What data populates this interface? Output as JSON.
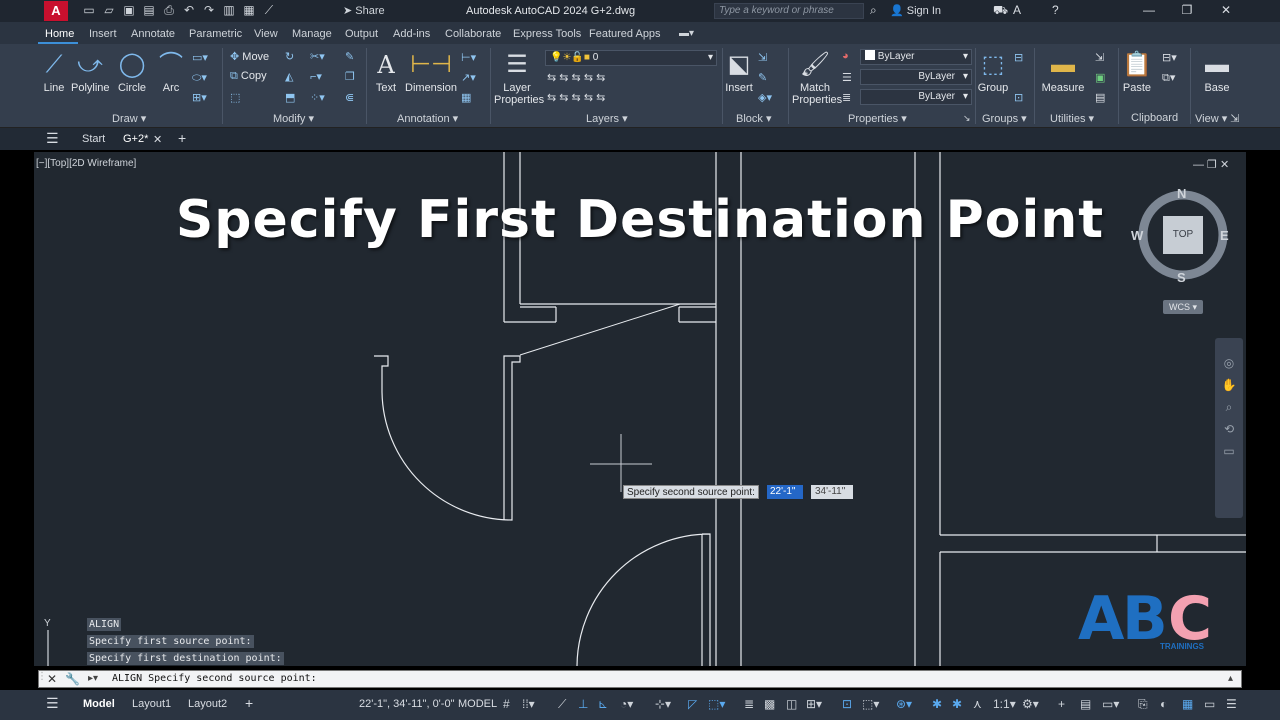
{
  "titlebar": {
    "logo": "A",
    "share": "Share",
    "title": "Autodesk AutoCAD 2024   G+2.dwg",
    "search_placeholder": "Type a keyword or phrase",
    "sign_in": "Sign In"
  },
  "ribbon_tabs": [
    "Home",
    "Insert",
    "Annotate",
    "Parametric",
    "View",
    "Manage",
    "Output",
    "Add-ins",
    "Collaborate",
    "Express Tools",
    "Featured Apps"
  ],
  "ribbon": {
    "draw": {
      "line": "Line",
      "polyline": "Polyline",
      "circle": "Circle",
      "arc": "Arc",
      "title": "Draw"
    },
    "modify": {
      "move": "Move",
      "copy": "Copy",
      "title": "Modify"
    },
    "annotation": {
      "text": "Text",
      "dimension": "Dimension",
      "title": "Annotation"
    },
    "layers": {
      "layer_properties_1": "Layer",
      "layer_properties_2": "Properties",
      "current_layer": "0",
      "title": "Layers"
    },
    "block": {
      "insert": "Insert",
      "title": "Block"
    },
    "properties": {
      "match_1": "Match",
      "match_2": "Properties",
      "color": "ByLayer",
      "linetype": "ByLayer",
      "lineweight": "ByLayer",
      "title": "Properties"
    },
    "groups": {
      "group": "Group",
      "title": "Groups"
    },
    "utilities": {
      "measure": "Measure",
      "title": "Utilities"
    },
    "clipboard": {
      "paste": "Paste",
      "title": "Clipboard"
    },
    "view": {
      "base": "Base",
      "title": "View"
    }
  },
  "file_tabs": {
    "start": "Start",
    "current": "G+2*"
  },
  "viewport": {
    "label": "[−][Top][2D Wireframe]",
    "overlay_title": "Specify First Destination Point",
    "viewcube": {
      "north": "N",
      "south": "S",
      "east": "E",
      "west": "W",
      "top": "TOP",
      "wcs": "WCS"
    }
  },
  "tooltip": {
    "prompt": "Specify second source point:",
    "x_value": "22'-1\"",
    "y_value": "34'-11\""
  },
  "command_history": [
    "ALIGN",
    "Specify first source point:",
    "Specify first destination point:"
  ],
  "command_line": "ALIGN Specify second source point:",
  "statusbar": {
    "model": "Model",
    "layout1": "Layout1",
    "layout2": "Layout2",
    "coords": "22'-1\", 34'-11\", 0'-0\"",
    "model_space": "MODEL",
    "scale": "1:1"
  },
  "logo": {
    "letters": "ABC",
    "sub": "TRAININGS"
  },
  "colors": {
    "accent": "#3c8fd8",
    "canvas": "#212830",
    "logo_blue": "#1f6fc1",
    "logo_pink": "#f3a1b1"
  }
}
